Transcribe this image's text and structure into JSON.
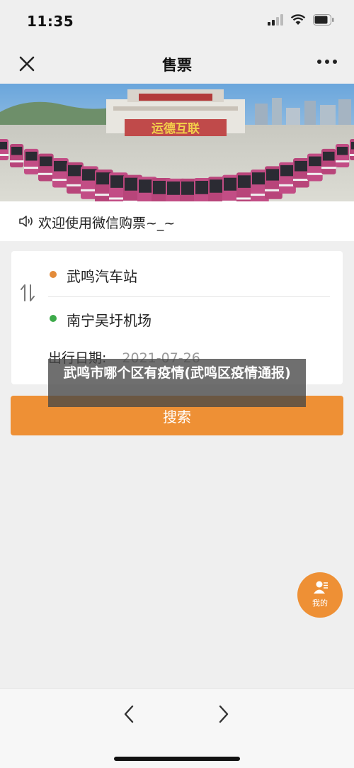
{
  "status_bar": {
    "time": "11:35"
  },
  "header": {
    "title": "售票"
  },
  "banner": {
    "sign_text": "运德互联"
  },
  "notice": {
    "text": "欢迎使用微信购票~_~"
  },
  "trip": {
    "origin": "武鸣汽车站",
    "destination": "南宁吴圩机场",
    "date_label": "出行日期:",
    "date_value": "2021-07-26"
  },
  "search_button": {
    "label": "搜索"
  },
  "overlay_caption": {
    "text": "武鸣市哪个区有疫情(武鸣区疫情通报)"
  },
  "fab": {
    "label": "我的"
  },
  "colors": {
    "accent": "#ee9035",
    "destination_dot": "#3daa4a",
    "origin_dot": "#e38b3a"
  },
  "icons": {
    "close": "close-icon",
    "more": "more-icon",
    "speaker": "speaker-icon",
    "swap": "swap-icon",
    "user": "user-icon",
    "back": "chevron-left-icon",
    "forward": "chevron-right-icon"
  }
}
